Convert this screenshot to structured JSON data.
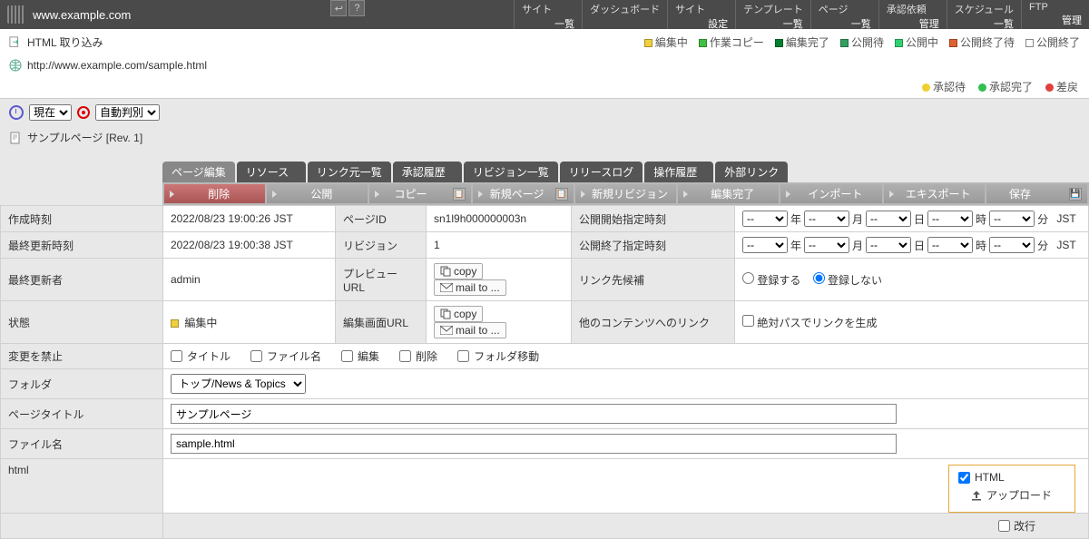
{
  "topbar": {
    "domain": "www.example.com",
    "nav": [
      {
        "top": "サイト",
        "bottom": "一覧"
      },
      {
        "top": "ダッシュボード",
        "bottom": ""
      },
      {
        "top": "サイト",
        "bottom": "設定"
      },
      {
        "top": "テンプレート",
        "bottom": "一覧"
      },
      {
        "top": "ページ",
        "bottom": "一覧"
      },
      {
        "top": "承認依頼",
        "bottom": "管理"
      },
      {
        "top": "スケジュール",
        "bottom": "一覧"
      },
      {
        "top": "FTP",
        "bottom": "管理"
      }
    ]
  },
  "legend1": {
    "title": "HTML 取り込み",
    "items": [
      {
        "color": "#f0d040",
        "label": "編集中"
      },
      {
        "color": "#40c040",
        "label": "作業コピー"
      },
      {
        "color": "#008030",
        "label": "編集完了"
      },
      {
        "color": "#30a060",
        "label": "公開待"
      },
      {
        "color": "#30d070",
        "label": "公開中"
      },
      {
        "color": "#e06030",
        "label": "公開終了待"
      },
      {
        "color": "",
        "label": "公開終了",
        "hollow": true
      }
    ]
  },
  "url": "http://www.example.com/sample.html",
  "legend2": [
    {
      "color": "#f0d030",
      "label": "承認待"
    },
    {
      "color": "#30c050",
      "label": "承認完了"
    },
    {
      "color": "#e04040",
      "label": "差戻"
    }
  ],
  "time": {
    "now": "現在",
    "auto": "自動判別"
  },
  "page_title_row": "サンプルページ [Rev. 1]",
  "tabs": [
    "ページ編集",
    "リソース",
    "リンク元一覧",
    "承認履歴",
    "リビジョン一覧",
    "リリースログ",
    "操作履歴",
    "外部リンク"
  ],
  "toolbar": {
    "delete": "削除",
    "publish": "公開",
    "copy": "コピー",
    "new_page": "新規ページ",
    "new_rev": "新規リビジョン",
    "edit_done": "編集完了",
    "import": "インポート",
    "export": "エキスポート",
    "save": "保存"
  },
  "form": {
    "created_label": "作成時刻",
    "created_value": "2022/08/23 19:00:26 JST",
    "page_id_label": "ページID",
    "page_id_value": "sn1l9h000000003n",
    "pub_start_label": "公開開始指定時刻",
    "updated_label": "最終更新時刻",
    "updated_value": "2022/08/23 19:00:38 JST",
    "revision_label": "リビジョン",
    "revision_value": "1",
    "pub_end_label": "公開終了指定時刻",
    "updater_label": "最終更新者",
    "updater_value": "admin",
    "preview_url_label": "プレビューURL",
    "copy_btn": "copy",
    "mail_btn": "mail to ...",
    "link_cand_label": "リンク先候補",
    "register_yes": "登録する",
    "register_no": "登録しない",
    "state_label": "状態",
    "state_value": "編集中",
    "edit_url_label": "編集画面URL",
    "other_link_label": "他のコンテンツへのリンク",
    "abs_path_label": "絶対パスでリンクを生成",
    "forbid_label": "変更を禁止",
    "chk_title": "タイトル",
    "chk_filename": "ファイル名",
    "chk_edit": "編集",
    "chk_delete": "削除",
    "chk_folder_move": "フォルダ移動",
    "folder_label": "フォルダ",
    "folder_value": "トップ/News & Topics",
    "title_label": "ページタイトル",
    "title_value": "サンプルページ",
    "filename_label": "ファイル名",
    "filename_value": "sample.html",
    "html_label": "html",
    "html_panel_label": "HTML",
    "upload_label": "アップロード",
    "kaigyo_label": "改行",
    "date_units": {
      "y": "年",
      "m": "月",
      "d": "日",
      "h": "時",
      "min": "分",
      "tz": "JST",
      "dash": "--"
    }
  }
}
